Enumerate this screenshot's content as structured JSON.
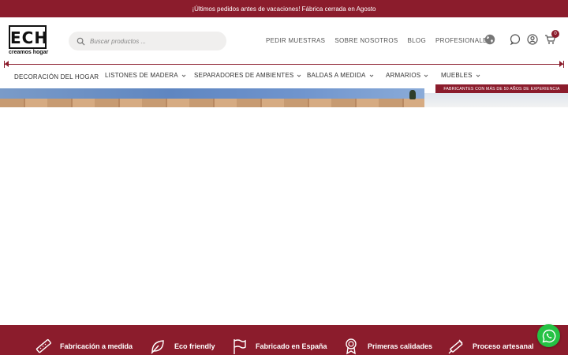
{
  "topbar": {
    "announcement": "¡Últimos pedidos antes de vacaciones! Fábrica cerrada en Agosto"
  },
  "brand": {
    "logo_letters": "ECH",
    "tagline": "creamos hogar"
  },
  "search": {
    "placeholder": "Buscar productos ..."
  },
  "header_nav": [
    {
      "label": "PEDIR MUESTRAS"
    },
    {
      "label": "SOBRE NOSOTROS"
    },
    {
      "label": "BLOG"
    },
    {
      "label": "PROFESIONALES"
    }
  ],
  "header_icons": [
    "globe-icon",
    "chat-icon",
    "user-icon",
    "cart-icon"
  ],
  "cart": {
    "count": "0"
  },
  "main_nav": [
    {
      "label": "DECORACIÓN DEL HOGAR",
      "has_dropdown": false
    },
    {
      "label": "LISTONES DE MADERA",
      "has_dropdown": true
    },
    {
      "label": "SEPARADORES DE AMBIENTES",
      "has_dropdown": true
    },
    {
      "label": "BALDAS A MEDIDA",
      "has_dropdown": true
    },
    {
      "label": "ARMARIOS",
      "has_dropdown": true
    },
    {
      "label": "MUEBLES",
      "has_dropdown": true
    }
  ],
  "promo": {
    "text": "FABRICANTES CON MÁS DE 50 AÑOS DE EXPERIENCIA"
  },
  "features": [
    {
      "label": "Fabricación a medida",
      "icon": "ruler-icon"
    },
    {
      "label": "Eco friendly",
      "icon": "leaf-icon"
    },
    {
      "label": "Fabricado en España",
      "icon": "flag-icon"
    },
    {
      "label": "Primeras calidades",
      "icon": "award-icon"
    },
    {
      "label": "Proceso artesanal",
      "icon": "tools-icon"
    }
  ],
  "colors": {
    "brand": "#8b1c2c",
    "whatsapp": "#25c244",
    "search_bg": "#f0efee"
  }
}
